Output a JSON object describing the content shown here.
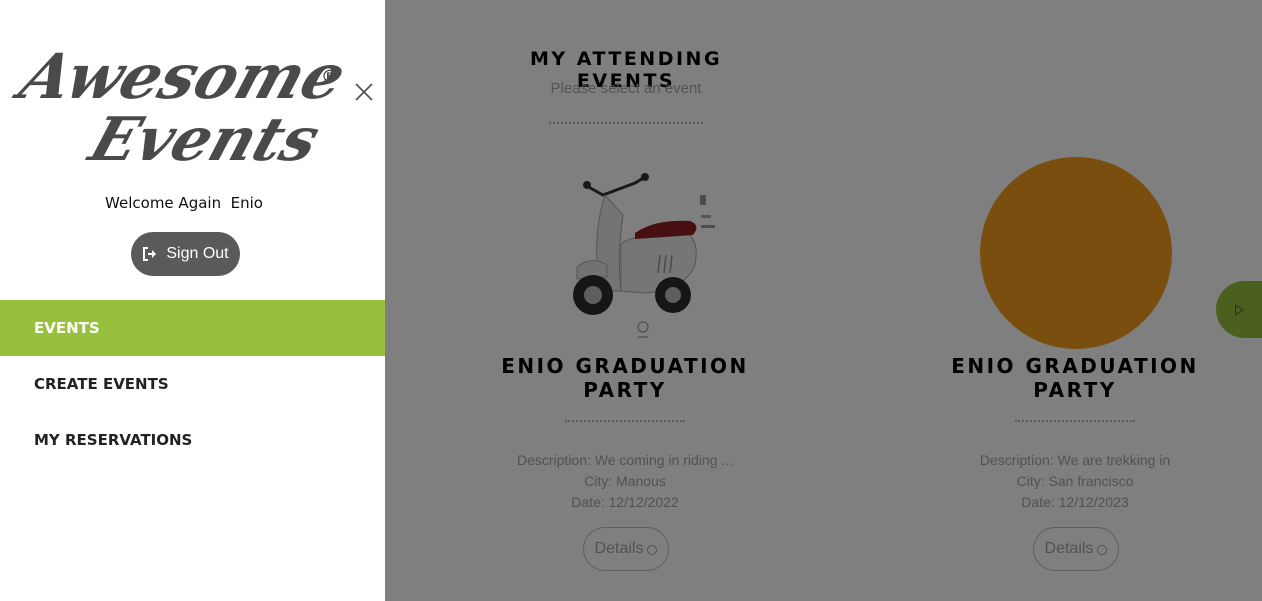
{
  "sidebar": {
    "logo_line1": "Awesome",
    "logo_line2": "Events",
    "logo_mark": "®",
    "welcome": "Welcome Again  Enio",
    "sign_out": "Sign Out",
    "nav": [
      {
        "label": "EVENTS",
        "active": true
      },
      {
        "label": "CREATE EVENTS",
        "active": false
      },
      {
        "label": "MY RESERVATIONS",
        "active": false
      }
    ]
  },
  "main": {
    "title": "MY ATTENDING EVENTS",
    "subtitle": "Please select an event",
    "events": [
      {
        "title_line1": "ENIO GRADUATION",
        "title_line2": "PARTY",
        "description": "Description: We coming in riding ...",
        "city": "City: Manous",
        "date": "Date: 12/12/2022",
        "details": "Details",
        "image": "scooter"
      },
      {
        "title_line1": "ENIO GRADUATION",
        "title_line2": "PARTY",
        "description": "Description: We are trekking in",
        "city": "City: San francisco",
        "date": "Date: 12/12/2023",
        "details": "Details",
        "image": "orange-circle"
      }
    ]
  },
  "colors": {
    "accent": "#97c13d",
    "overlay": "rgba(0,0,0,0.5)",
    "signout_bg": "#5a5a5a",
    "event_circle": "#f39c1f"
  }
}
